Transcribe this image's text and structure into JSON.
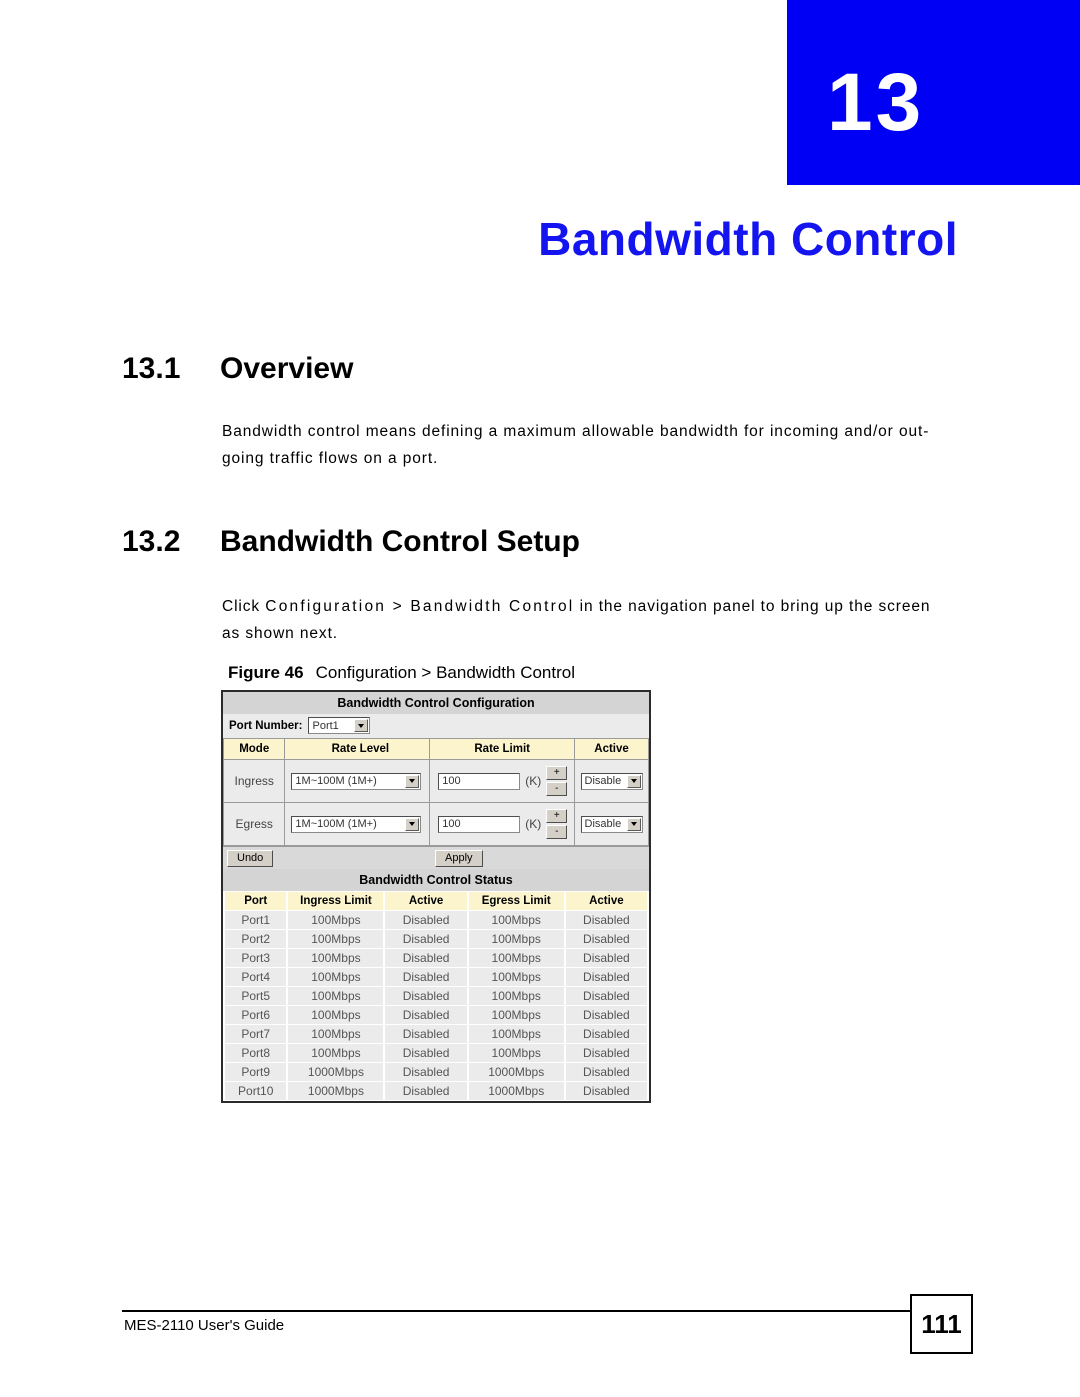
{
  "chapter": {
    "number": "13",
    "title": "Bandwidth Control",
    "banner_color": "#0000f5",
    "title_color": "#1414f0"
  },
  "sections": {
    "overview": {
      "number": "13.1",
      "heading": "Overview",
      "paragraph": "Bandwidth control means defining a maximum allowable bandwidth for incoming and/or out-going traffic flows on a port."
    },
    "setup": {
      "number": "13.2",
      "heading": "Bandwidth Control Setup",
      "paragraph_prefix": "Click ",
      "paragraph_path": "Configuration > Bandwidth Control",
      "paragraph_suffix": " in the navigation panel to bring up the screen as shown next."
    }
  },
  "figure": {
    "label": "Figure 46",
    "caption": "Configuration > Bandwidth Control"
  },
  "screenshot": {
    "config_panel": {
      "title": "Bandwidth Control Configuration",
      "port_number_label": "Port Number:",
      "port_number_value": "Port1",
      "columns": [
        "Mode",
        "Rate Level",
        "Rate Limit",
        "Active"
      ],
      "unit_label": "(K)",
      "increment_label": "+",
      "decrement_label": "-",
      "rows": [
        {
          "mode": "Ingress",
          "rate_level": "1M~100M (1M+)",
          "rate_limit": "100",
          "active": "Disable"
        },
        {
          "mode": "Egress",
          "rate_level": "1M~100M (1M+)",
          "rate_limit": "100",
          "active": "Disable"
        }
      ],
      "undo_label": "Undo",
      "apply_label": "Apply"
    },
    "status_panel": {
      "title": "Bandwidth Control Status",
      "columns": [
        "Port",
        "Ingress Limit",
        "Active",
        "Egress Limit",
        "Active"
      ],
      "rows": [
        [
          "Port1",
          "100Mbps",
          "Disabled",
          "100Mbps",
          "Disabled"
        ],
        [
          "Port2",
          "100Mbps",
          "Disabled",
          "100Mbps",
          "Disabled"
        ],
        [
          "Port3",
          "100Mbps",
          "Disabled",
          "100Mbps",
          "Disabled"
        ],
        [
          "Port4",
          "100Mbps",
          "Disabled",
          "100Mbps",
          "Disabled"
        ],
        [
          "Port5",
          "100Mbps",
          "Disabled",
          "100Mbps",
          "Disabled"
        ],
        [
          "Port6",
          "100Mbps",
          "Disabled",
          "100Mbps",
          "Disabled"
        ],
        [
          "Port7",
          "100Mbps",
          "Disabled",
          "100Mbps",
          "Disabled"
        ],
        [
          "Port8",
          "100Mbps",
          "Disabled",
          "100Mbps",
          "Disabled"
        ],
        [
          "Port9",
          "1000Mbps",
          "Disabled",
          "1000Mbps",
          "Disabled"
        ],
        [
          "Port10",
          "1000Mbps",
          "Disabled",
          "1000Mbps",
          "Disabled"
        ]
      ]
    }
  },
  "footer": {
    "guide_name": "MES-2110 User's Guide",
    "page_number": "111"
  }
}
